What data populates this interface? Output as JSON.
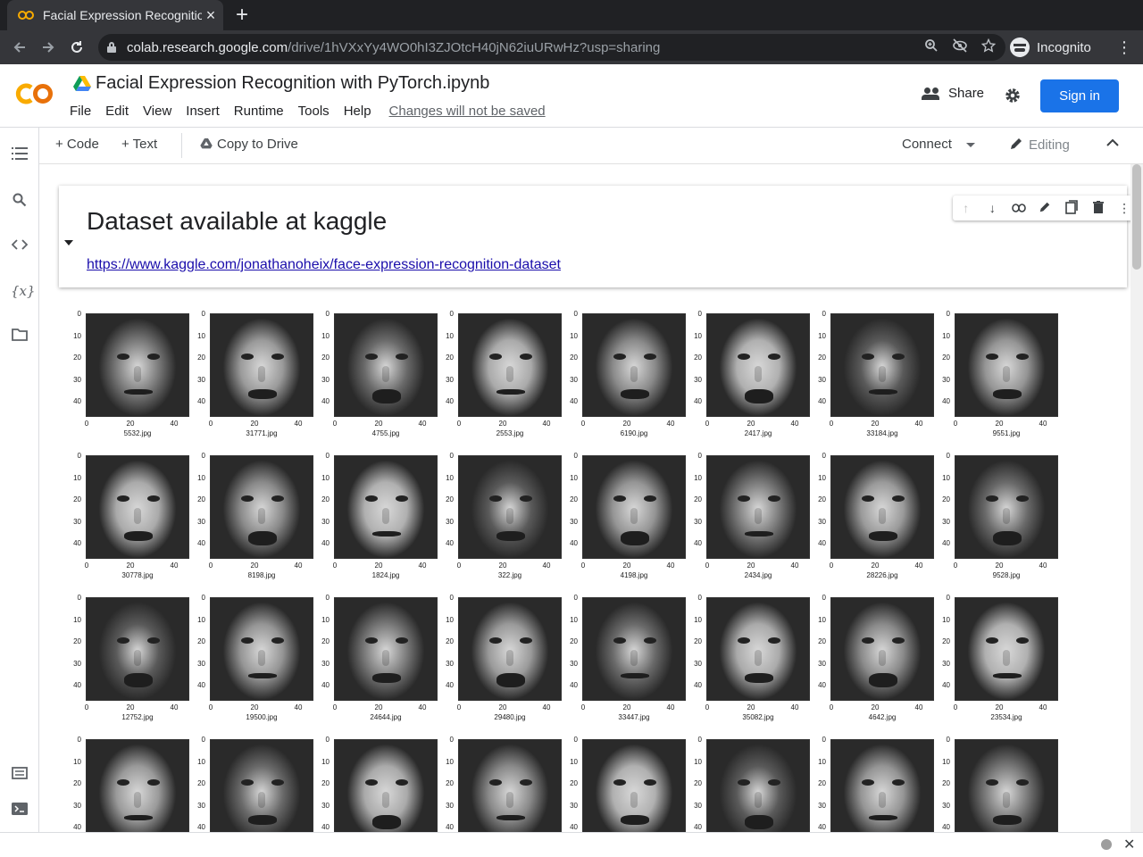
{
  "browser": {
    "tab_title": "Facial Expression Recognition with PyTorch.ipynb - Colaboratory",
    "tab_close": "×",
    "new_tab": "+",
    "url_host": "colab.research.google.com",
    "url_rest": "/drive/1hVXxYy4WO0hI3ZJOtcH40jN62iuURwHz?usp=sharing",
    "profile_label": "Incognito",
    "icons": [
      "back-icon",
      "forward-icon",
      "reload-icon",
      "lock-icon",
      "zoom-icon",
      "eye-off-icon",
      "star-icon",
      "incognito-icon",
      "kebab-icon"
    ]
  },
  "colab": {
    "notebook_title": "Facial Expression Recognition with PyTorch.ipynb",
    "menu": [
      "File",
      "Edit",
      "View",
      "Insert",
      "Runtime",
      "Tools",
      "Help"
    ],
    "unsaved_notice": "Changes will not be saved",
    "share_label": "Share",
    "signin_label": "Sign in",
    "brand_color": "#f9ab00",
    "accent_color": "#1a73e8"
  },
  "toolbar": {
    "code_label": "+ Code",
    "text_label": "+ Text",
    "copy_label": "Copy to Drive",
    "connect_label": "Connect",
    "editing_label": "Editing"
  },
  "sidebar": {
    "icons": [
      "toc-icon",
      "search-icon",
      "code-snippets-icon",
      "variables-icon",
      "files-icon",
      "command-palette-icon",
      "terminal-icon"
    ]
  },
  "text_cell": {
    "heading": "Dataset available at kaggle",
    "link": "https://www.kaggle.com/jonathanoheix/face-expression-recognition-dataset",
    "toolbar_icons": [
      "move-up-icon",
      "move-down-icon",
      "link-icon",
      "edit-icon",
      "mirror-cell-icon",
      "delete-icon",
      "more-icon"
    ]
  },
  "images": {
    "y_ticks": [
      "0",
      "10",
      "20",
      "30",
      "40"
    ],
    "x_ticks": [
      "0",
      "20",
      "40"
    ],
    "filenames": [
      [
        "5532.jpg",
        "31771.jpg",
        "4755.jpg",
        "2553.jpg",
        "6190.jpg",
        "2417.jpg",
        "33184.jpg",
        "9551.jpg"
      ],
      [
        "30778.jpg",
        "8198.jpg",
        "1824.jpg",
        "322.jpg",
        "4198.jpg",
        "2434.jpg",
        "28226.jpg",
        "9528.jpg"
      ],
      [
        "12752.jpg",
        "19500.jpg",
        "24644.jpg",
        "29480.jpg",
        "33447.jpg",
        "35082.jpg",
        "4642.jpg",
        "23534.jpg"
      ],
      [
        "",
        "",
        "",
        "",
        "",
        "",
        "",
        ""
      ]
    ]
  }
}
